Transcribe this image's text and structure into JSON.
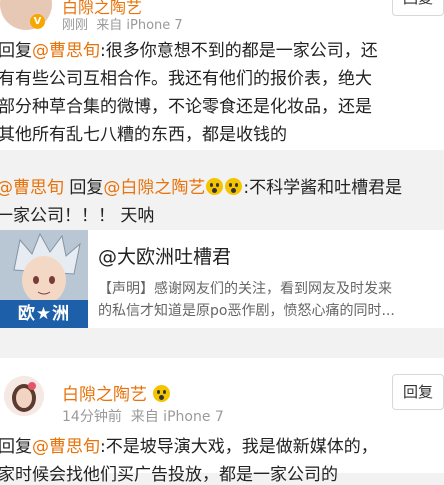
{
  "post1": {
    "author": "白隙之陶艺",
    "time": "刚刚",
    "source": "来自 iPhone 7",
    "reply_button": "回复",
    "lines": [
      {
        "prefix": "回复",
        "mention": "@曹思旬",
        "rest": ":很多你意想不到的都是一家公司，还"
      },
      {
        "text": "有有些公司互相合作。我还有他们的报价表，绝大"
      },
      {
        "text": "部分种草合集的微博，不论零食还是化妆品，还是"
      },
      {
        "text": "其他所有乱七八糟的东西，都是收钱的"
      }
    ]
  },
  "retweet": {
    "mention1": "@曹思旬",
    "reply_word": " 回复",
    "mention2": "@白隙之陶艺",
    "line1_rest": ":不科学酱和吐槽君是",
    "line2": "一家公司！！！ 天呐",
    "link_card": {
      "title": "@大欧洲吐槽君",
      "desc_line1": "【声明】感谢网友们的关注，看到网友及时发来",
      "desc_line2": "的私信才知道是原po恶作剧，愤怒心痛的同时...",
      "thumb_banner": "欧★洲"
    }
  },
  "post2": {
    "author": "白隙之陶艺",
    "time": "14分钟前",
    "source": "来自 iPhone 7",
    "reply_button": "回复",
    "lines": [
      {
        "prefix": "回复",
        "mention": "@曹思旬",
        "rest": ":不是坡导演大戏，我是做新媒体的，"
      },
      {
        "text": "家时候会找他们买广告投放，都是一家公司的"
      }
    ]
  },
  "colors": {
    "accent": "#e8730a",
    "badge": "#f7a800",
    "banner": "#1d5fa8"
  }
}
